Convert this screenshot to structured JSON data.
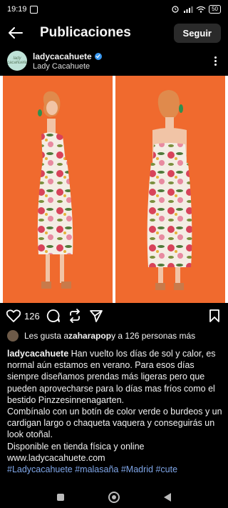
{
  "status": {
    "time": "19:19",
    "battery": "50"
  },
  "header": {
    "title": "Publicaciones",
    "follow_label": "Seguir"
  },
  "post": {
    "username": "ladycacahuete",
    "fullname": "Lady Cacahuete",
    "avatar_text": "lady cacahuete",
    "like_count": "126",
    "liked_by_prefix": "Les gusta a ",
    "liked_by_user": "zaharapop",
    "liked_by_suffix": " y a 126 personas más",
    "caption_user": "ladycacahuete",
    "caption_text": " Han vuelto los días de sol y calor, es normal aún estamos en verano. Para esos días siempre diseñamos prendas más ligeras pero que pueden aprovecharse para lo días mas fríos como el bestido Pinzzesinnenagarten.",
    "caption_line2": "Combínalo con un botín de color verde o burdeos y un cardigan largo o chaqueta vaquera y conseguirás un look otoñal.",
    "caption_line3": "Disponible en tienda física y online",
    "caption_line4": "www.ladycacahuete.com",
    "caption_tags": "#Ladycacahuete #malasaña #Madrid #cute"
  },
  "colors": {
    "background": "#000000",
    "photo_background": "#f06a2e",
    "link": "#7fa6e8",
    "verified": "#3897f0"
  },
  "icons": [
    "back-arrow-icon",
    "verified-icon",
    "more-icon",
    "heart-icon",
    "comment-icon",
    "repost-icon",
    "share-icon",
    "save-icon"
  ]
}
